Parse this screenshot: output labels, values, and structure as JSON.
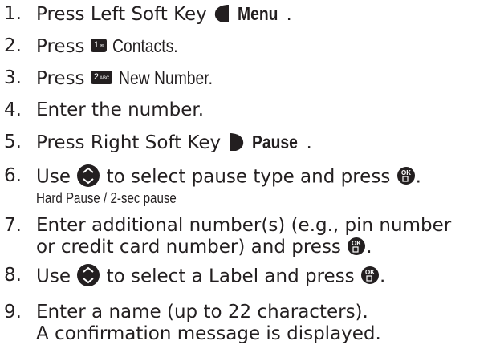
{
  "steps": [
    {
      "num": "1.",
      "pre": "Press Left Soft Key",
      "bold": "Menu",
      "post": "."
    },
    {
      "num": "2.",
      "pre": "Press",
      "key": "1",
      "key_sub": "✉",
      "post": "Contacts."
    },
    {
      "num": "3.",
      "pre": "Press",
      "key": "2",
      "key_sub": "ABC",
      "post": "New Number."
    },
    {
      "num": "4.",
      "text": "Enter the number."
    },
    {
      "num": "5.",
      "pre": "Press Right Soft Key",
      "bold": "Pause",
      "post": "."
    },
    {
      "num": "6.",
      "pre": "Use",
      "mid": "to select pause type and press",
      "post": ".",
      "note": "Hard Pause / 2-sec pause"
    },
    {
      "num": "7.",
      "line1": "Enter additional number(s) (e.g., pin number",
      "line2": "or credit card number) and press",
      "post": "."
    },
    {
      "num": "8.",
      "pre": "Use",
      "mid": "to select a Label and press",
      "post": "."
    },
    {
      "num": "9.",
      "line1": "Enter a name (up to 22 characters).",
      "line2": "A confirmation message is displayed."
    }
  ],
  "icons": {
    "left_soft_key": "left-soft-key-icon",
    "right_soft_key": "right-soft-key-icon",
    "nav": "navigation-key-icon",
    "ok": "ok-key-icon"
  }
}
